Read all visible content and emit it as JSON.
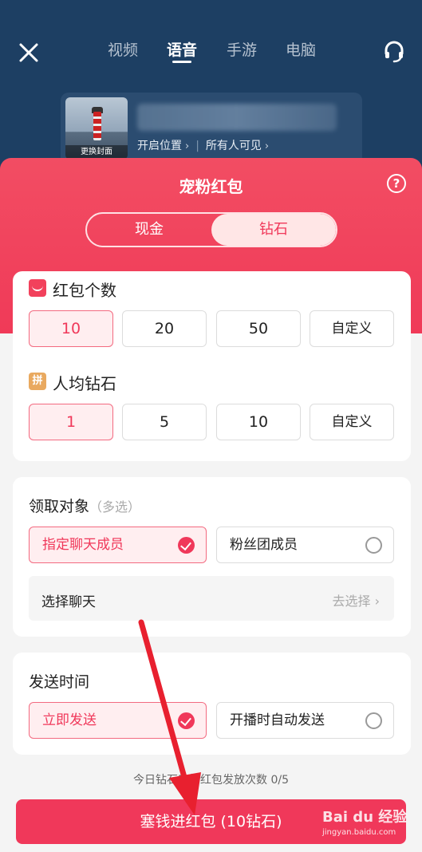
{
  "header": {
    "tabs": [
      {
        "label": "视频",
        "active": false
      },
      {
        "label": "语音",
        "active": true
      },
      {
        "label": "手游",
        "active": false
      },
      {
        "label": "电脑",
        "active": false
      }
    ],
    "close_icon": "close-icon",
    "support_icon": "headset-icon"
  },
  "room_card": {
    "cover_label": "更换封面",
    "location": "开启位置",
    "visibility": "所有人可见"
  },
  "sheet": {
    "title": "宠粉红包",
    "help": "?",
    "toggle": {
      "left": "现金",
      "right": "钻石",
      "selected": "钻石"
    }
  },
  "count_section": {
    "title": "红包个数",
    "options": [
      "10",
      "20",
      "50",
      "自定义"
    ],
    "selected": "10"
  },
  "diamond_section": {
    "title": "人均钻石",
    "icon_text": "拼",
    "options": [
      "1",
      "5",
      "10",
      "自定义"
    ],
    "selected": "1"
  },
  "target_section": {
    "title": "领取对象",
    "subtitle": "（多选）",
    "options": [
      {
        "label": "指定聊天成员",
        "checked": true
      },
      {
        "label": "粉丝团成员",
        "checked": false
      }
    ],
    "select_chat": {
      "label": "选择聊天",
      "action": "去选择"
    }
  },
  "time_section": {
    "title": "发送时间",
    "options": [
      {
        "label": "立即发送",
        "checked": true
      },
      {
        "label": "开播时自动发送",
        "checked": false
      }
    ]
  },
  "footer": {
    "note": "今日钻石宠粉红包发放次数 0/5",
    "submit": "塞钱进红包 (10钻石)"
  },
  "watermark": {
    "brand": "Bai du 经验",
    "url": "jingyan.baidu.com"
  },
  "colors": {
    "accent": "#f0385a",
    "topbar": "#1d3f63",
    "annotation": "#e8202f"
  }
}
